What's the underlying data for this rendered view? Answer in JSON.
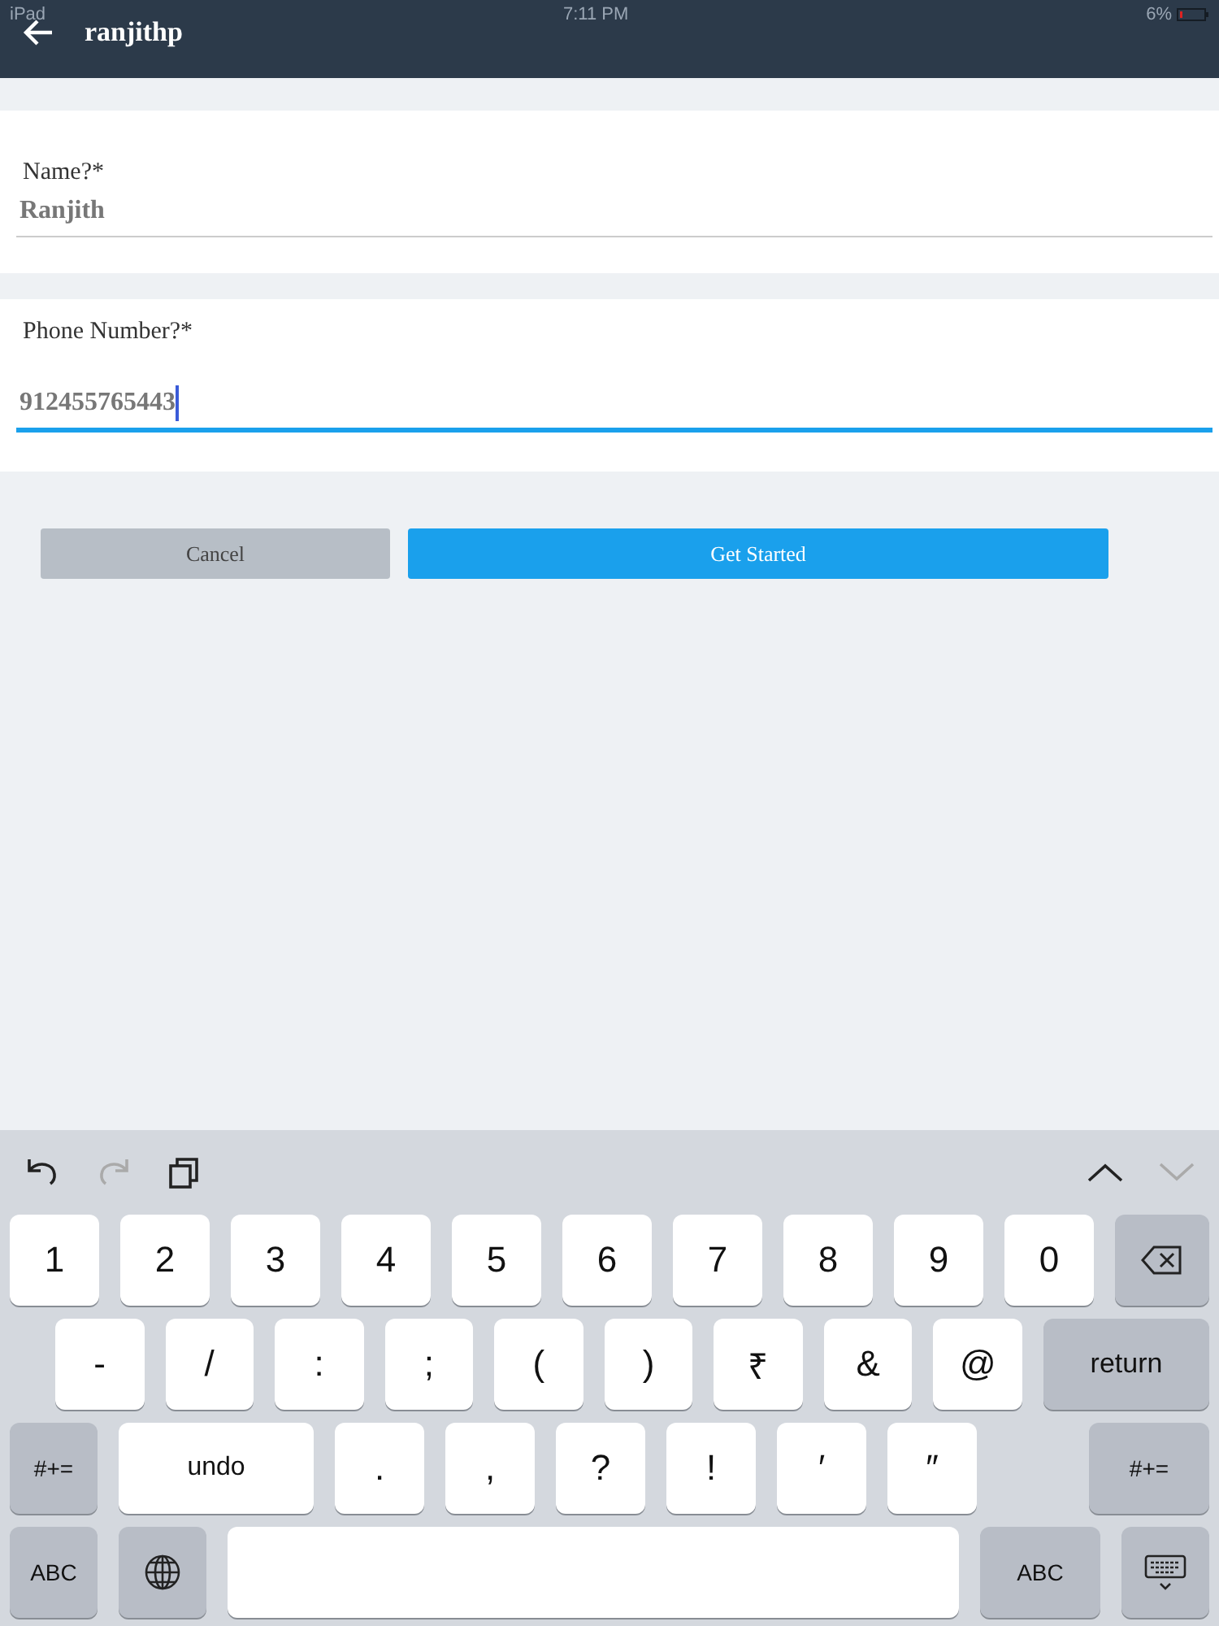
{
  "status_bar": {
    "device": "iPad",
    "time": "7:11 PM",
    "battery": "6%"
  },
  "nav": {
    "title": "ranjithp"
  },
  "fields": [
    {
      "label": "Name?*",
      "value": "Ranjith",
      "focused": false
    },
    {
      "label": "Phone Number?*",
      "value": "912455765443",
      "focused": true
    }
  ],
  "buttons": [
    {
      "label": "Cancel",
      "kind": "secondary"
    },
    {
      "label": "Get Started",
      "kind": "primary"
    }
  ],
  "keyboard": {
    "rows": [
      [
        {
          "label": "1",
          "kind": "char"
        },
        {
          "label": "2",
          "kind": "char"
        },
        {
          "label": "3",
          "kind": "char"
        },
        {
          "label": "4",
          "kind": "char"
        },
        {
          "label": "5",
          "kind": "char"
        },
        {
          "label": "6",
          "kind": "char"
        },
        {
          "label": "7",
          "kind": "char"
        },
        {
          "label": "8",
          "kind": "char"
        },
        {
          "label": "9",
          "kind": "char"
        },
        {
          "label": "0",
          "kind": "char"
        },
        {
          "kind": "delete"
        }
      ],
      [
        {
          "label": "-",
          "kind": "char"
        },
        {
          "label": "/",
          "kind": "char"
        },
        {
          "label": ":",
          "kind": "char"
        },
        {
          "label": ";",
          "kind": "char"
        },
        {
          "label": "(",
          "kind": "char"
        },
        {
          "label": ")",
          "kind": "char"
        },
        {
          "label": "₹",
          "kind": "char"
        },
        {
          "label": "&",
          "kind": "char"
        },
        {
          "label": "@",
          "kind": "char"
        },
        {
          "label": "return",
          "kind": "return"
        }
      ],
      [
        {
          "label": "#+=",
          "kind": "symbols"
        },
        {
          "label": "undo",
          "kind": "wide"
        },
        {
          "label": ".",
          "kind": "char"
        },
        {
          "label": ",",
          "kind": "char"
        },
        {
          "label": "?",
          "kind": "char"
        },
        {
          "label": "!",
          "kind": "char"
        },
        {
          "label": "′",
          "kind": "char"
        },
        {
          "label": "″",
          "kind": "char"
        },
        {
          "label": "#+=",
          "kind": "symbols-end"
        }
      ],
      [
        {
          "label": "ABC",
          "kind": "abc"
        },
        {
          "kind": "globe"
        },
        {
          "kind": "space"
        },
        {
          "label": "ABC",
          "kind": "abc-end"
        },
        {
          "kind": "hide"
        }
      ]
    ]
  }
}
